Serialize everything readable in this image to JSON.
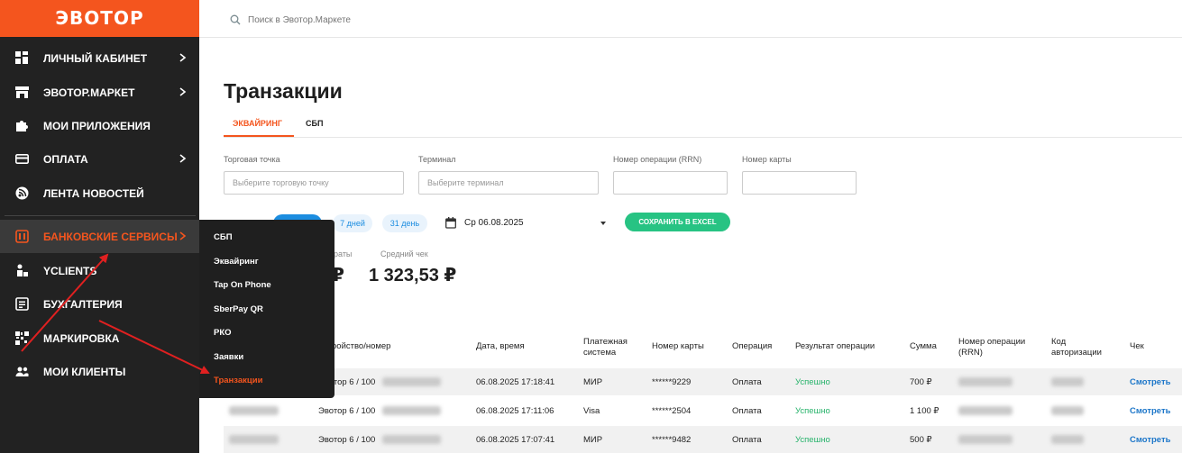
{
  "brand": {
    "logo": "ЭВОТОР",
    "accent": "#f4551e",
    "sidebar_bg": "#222222"
  },
  "sidebar": {
    "items": [
      {
        "label": "ЛИЧНЫЙ КАБИНЕТ",
        "icon": "dashboard-icon",
        "chevron": true
      },
      {
        "label": "ЭВОТОР.МАРКЕТ",
        "icon": "store-icon",
        "chevron": true
      },
      {
        "label": "МОИ ПРИЛОЖЕНИЯ",
        "icon": "puzzle-icon",
        "chevron": false
      },
      {
        "label": "ОПЛАТА",
        "icon": "card-icon",
        "chevron": true
      },
      {
        "label": "ЛЕНТА НОВОСТЕЙ",
        "icon": "news-icon",
        "chevron": false
      },
      {
        "label": "БАНКОВСКИЕ СЕРВИСЫ",
        "icon": "bank-icon",
        "chevron": true,
        "active": true
      },
      {
        "label": "YCLIENTS",
        "icon": "yclients-icon",
        "chevron": false
      },
      {
        "label": "БУХГАЛТЕРИЯ",
        "icon": "accounting-icon",
        "chevron": false
      },
      {
        "label": "МАРКИРОВКА",
        "icon": "barcode-icon",
        "chevron": false
      },
      {
        "label": "МОИ КЛИЕНТЫ",
        "icon": "users-icon",
        "chevron": false
      }
    ]
  },
  "submenu": {
    "items": [
      "СБП",
      "Эквайринг",
      "Tap On Phone",
      "SberPay QR",
      "РКО",
      "Заявки",
      "Транзакции"
    ],
    "active_index": 6
  },
  "search": {
    "placeholder": "Поиск в Эвотор.Маркете"
  },
  "page": {
    "title": "Транзакции",
    "tabs": [
      {
        "label": "ЭКВАЙРИНГ",
        "active": true
      },
      {
        "label": "СБП",
        "active": false
      }
    ]
  },
  "filters": {
    "outlet": {
      "label": "Торговая точка",
      "placeholder": "Выберите торговую точку"
    },
    "terminal": {
      "label": "Терминал",
      "placeholder": "Выберите терминал"
    },
    "rrn": {
      "label": "Номер операции (RRN)",
      "placeholder": ""
    },
    "card": {
      "label": "Номер карты",
      "placeholder": ""
    }
  },
  "periods": {
    "days7": "7 дней",
    "days31": "31 день"
  },
  "date": {
    "value": "Ср 06.08.2025"
  },
  "excel_button": "СОХРАНИТЬ В EXCEL",
  "stats": {
    "partial_label": "раты",
    "partial_value": "₽",
    "avg_label": "Средний чек",
    "avg_value": "1 323,53 ₽"
  },
  "table": {
    "headers": {
      "device": "ройство/номер",
      "datetime": "Дата, время",
      "system": "Платежная система",
      "card": "Номер карты",
      "operation": "Операция",
      "result": "Результат операции",
      "amount": "Сумма",
      "rrn": "Номер операции (RRN)",
      "auth": "Код авторизации",
      "receipt": "Чек"
    },
    "rows": [
      {
        "device": "Эвотор 6 / 100",
        "datetime": "06.08.2025 17:18:41",
        "system": "МИР",
        "card": "******9229",
        "operation": "Оплата",
        "result": "Успешно",
        "amount": "700 ₽",
        "receipt": "Смотреть"
      },
      {
        "device": "Эвотор 6 / 100",
        "datetime": "06.08.2025 17:11:06",
        "system": "Visa",
        "card": "******2504",
        "operation": "Оплата",
        "result": "Успешно",
        "amount": "1 100 ₽",
        "receipt": "Смотреть"
      },
      {
        "device": "Эвотор 6 / 100",
        "datetime": "06.08.2025 17:07:41",
        "system": "МИР",
        "card": "******9482",
        "operation": "Оплата",
        "result": "Успешно",
        "amount": "500 ₽",
        "receipt": "Смотреть"
      }
    ]
  }
}
